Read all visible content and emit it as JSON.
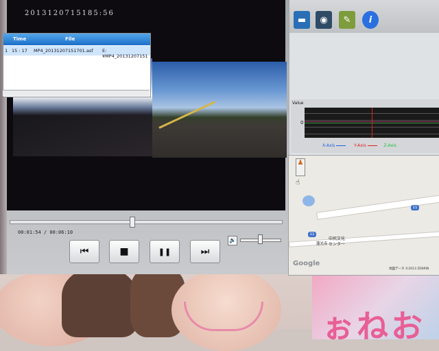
{
  "player": {
    "timestamp": "2013120715185:56",
    "time_display": "00:01:54 / 00:06:10",
    "seek_progress": 0.45,
    "volume": 0.45,
    "controls": {
      "prev": "⏮",
      "stop": "■",
      "pause": "❚❚",
      "next": "⏭"
    }
  },
  "toolbar": {
    "buttons": [
      {
        "icon": "folder-icon",
        "color": "#2a6fb6"
      },
      {
        "icon": "camera-icon",
        "color": "#2f4b66"
      },
      {
        "icon": "map-icon",
        "color": "#7f9c3d"
      },
      {
        "icon": "info-icon",
        "color": "#2b6fe0"
      }
    ]
  },
  "filelist": {
    "headers": [
      "Time",
      "File"
    ],
    "rows": [
      {
        "index": "1",
        "time": "15 : 17",
        "file": "MP4_20131207151701.asf",
        "path": "E:¥MP4_20131207151"
      }
    ]
  },
  "graph": {
    "label": "Value",
    "zero_label": "0",
    "legend": [
      {
        "name": "X-Axis",
        "color": "#2060e0"
      },
      {
        "name": "Y-Axis",
        "color": "#e02020"
      },
      {
        "name": "Z-Axis",
        "color": "#20c040"
      }
    ]
  },
  "map": {
    "labels": [
      "中尻文化",
      "センター",
      "蓮光寺"
    ],
    "road_numbers": [
      "11",
      "11"
    ],
    "branding": "Google",
    "copyright": "地図データ ©2013 ZENRIN"
  },
  "poster": {
    "text": "ぉねお"
  }
}
